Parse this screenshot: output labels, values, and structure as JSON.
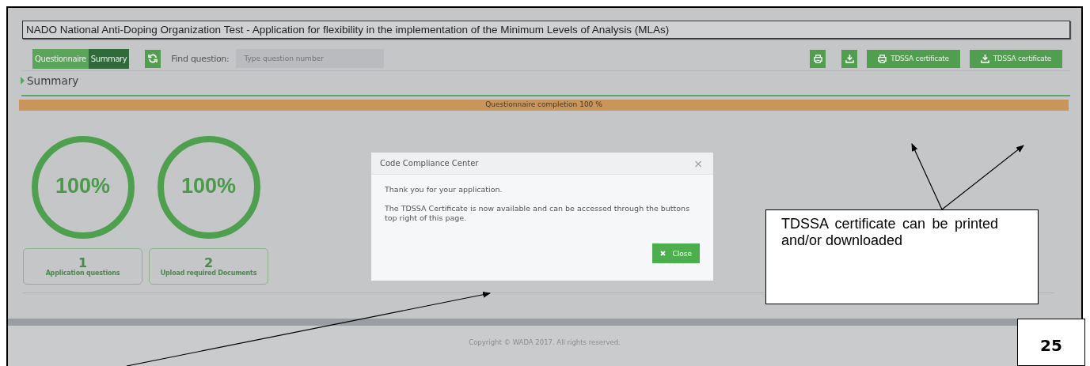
{
  "page_title": "NADO National Anti-Doping Organization Test - Application for flexibility in the implementation of the Minimum Levels of Analysis (MLAs)",
  "toolbar": {
    "view_tabs": [
      {
        "label": "Questionnaire",
        "selected": false
      },
      {
        "label": "Summary",
        "selected": true
      }
    ],
    "find_label": "Find question:",
    "find_field": {
      "placeholder": "Type question number"
    },
    "icon_buttons": [
      {
        "kind": "print"
      },
      {
        "kind": "download"
      }
    ],
    "certificate_buttons": [
      {
        "kind": "print",
        "label": "TDSSA certificate"
      },
      {
        "kind": "download",
        "label": "TDSSA certificate"
      }
    ]
  },
  "section_heading": "Summary",
  "progress": {
    "label": "Questionnaire completion 100 %",
    "level": 1
  },
  "gauges": [
    {
      "value": "100%",
      "level": 1,
      "count": "1",
      "caption": "Application questions"
    },
    {
      "value": "100%",
      "level": 1,
      "count": "2",
      "caption": "Upload required Documents"
    }
  ],
  "footer": "Copyright © WADA 2017. All rights reserved.",
  "dialog": {
    "title": "Code Compliance Center",
    "close_symbol": "×",
    "paragraphs": [
      "Thank you for your application.",
      "The TDSSA Certificate is now available and can be accessed through the buttons top right of this page."
    ],
    "close_button": "Close"
  },
  "callout": "TDSSA certificate can be printed and/or downloaded",
  "page_number": "25"
}
